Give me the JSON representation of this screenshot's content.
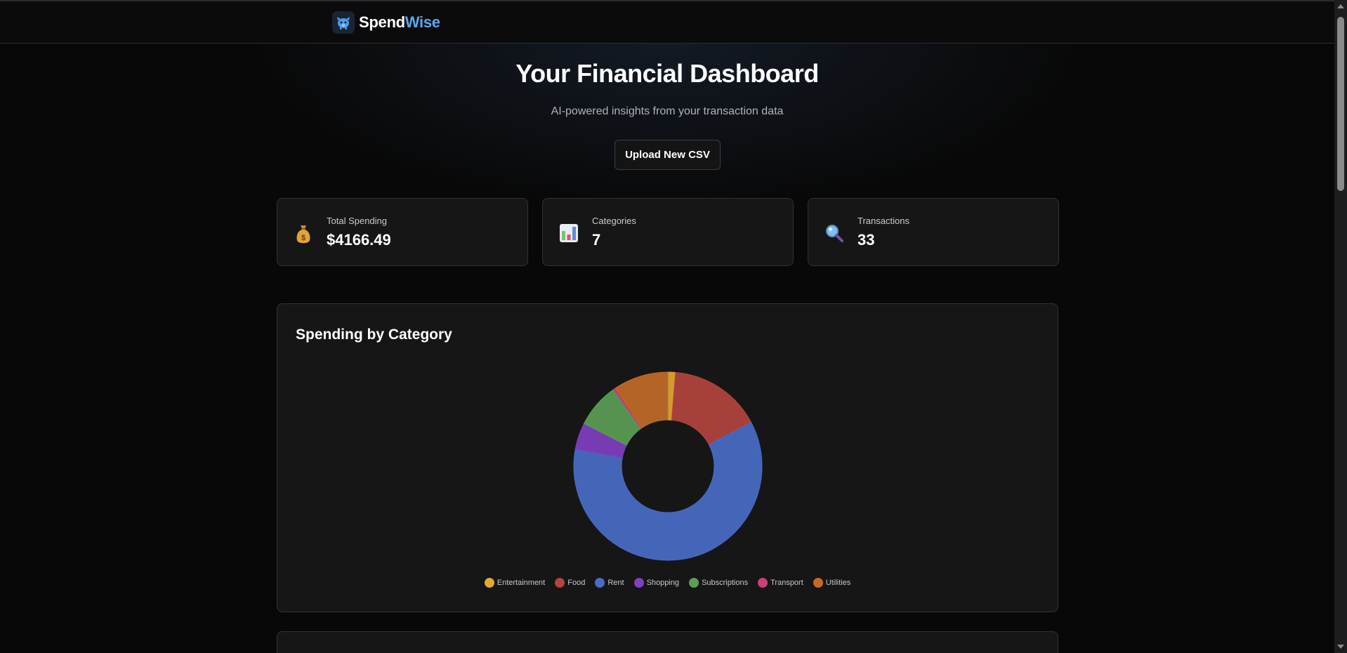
{
  "brand": {
    "name_part1": "Spend",
    "name_part2": "Wise",
    "logo_icon": "piggy-bank-icon"
  },
  "header": {
    "title": "Your Financial Dashboard",
    "subtitle": "AI-powered insights from your transaction data",
    "upload_label": "Upload New CSV"
  },
  "stats": [
    {
      "icon": "money-bag-icon",
      "label": "Total Spending",
      "value": "$4166.49"
    },
    {
      "icon": "bar-chart-icon",
      "label": "Categories",
      "value": "7"
    },
    {
      "icon": "magnifier-icon",
      "label": "Transactions",
      "value": "33"
    }
  ],
  "chart_section": {
    "title": "Spending by Category"
  },
  "chart_data": {
    "type": "pie",
    "variant": "donut",
    "title": "Spending by Category",
    "legend_position": "bottom",
    "categories": [
      "Entertainment",
      "Food",
      "Rent",
      "Shopping",
      "Subscriptions",
      "Transport",
      "Utilities"
    ],
    "values": [
      1.3,
      16.0,
      60.6,
      4.6,
      7.7,
      0.4,
      9.4
    ],
    "value_unit": "percent of total (estimated)",
    "colors": [
      "#e3a830",
      "#b3443f",
      "#4a6cc8",
      "#8040c2",
      "#5c9e57",
      "#c94178",
      "#c26b28"
    ]
  }
}
